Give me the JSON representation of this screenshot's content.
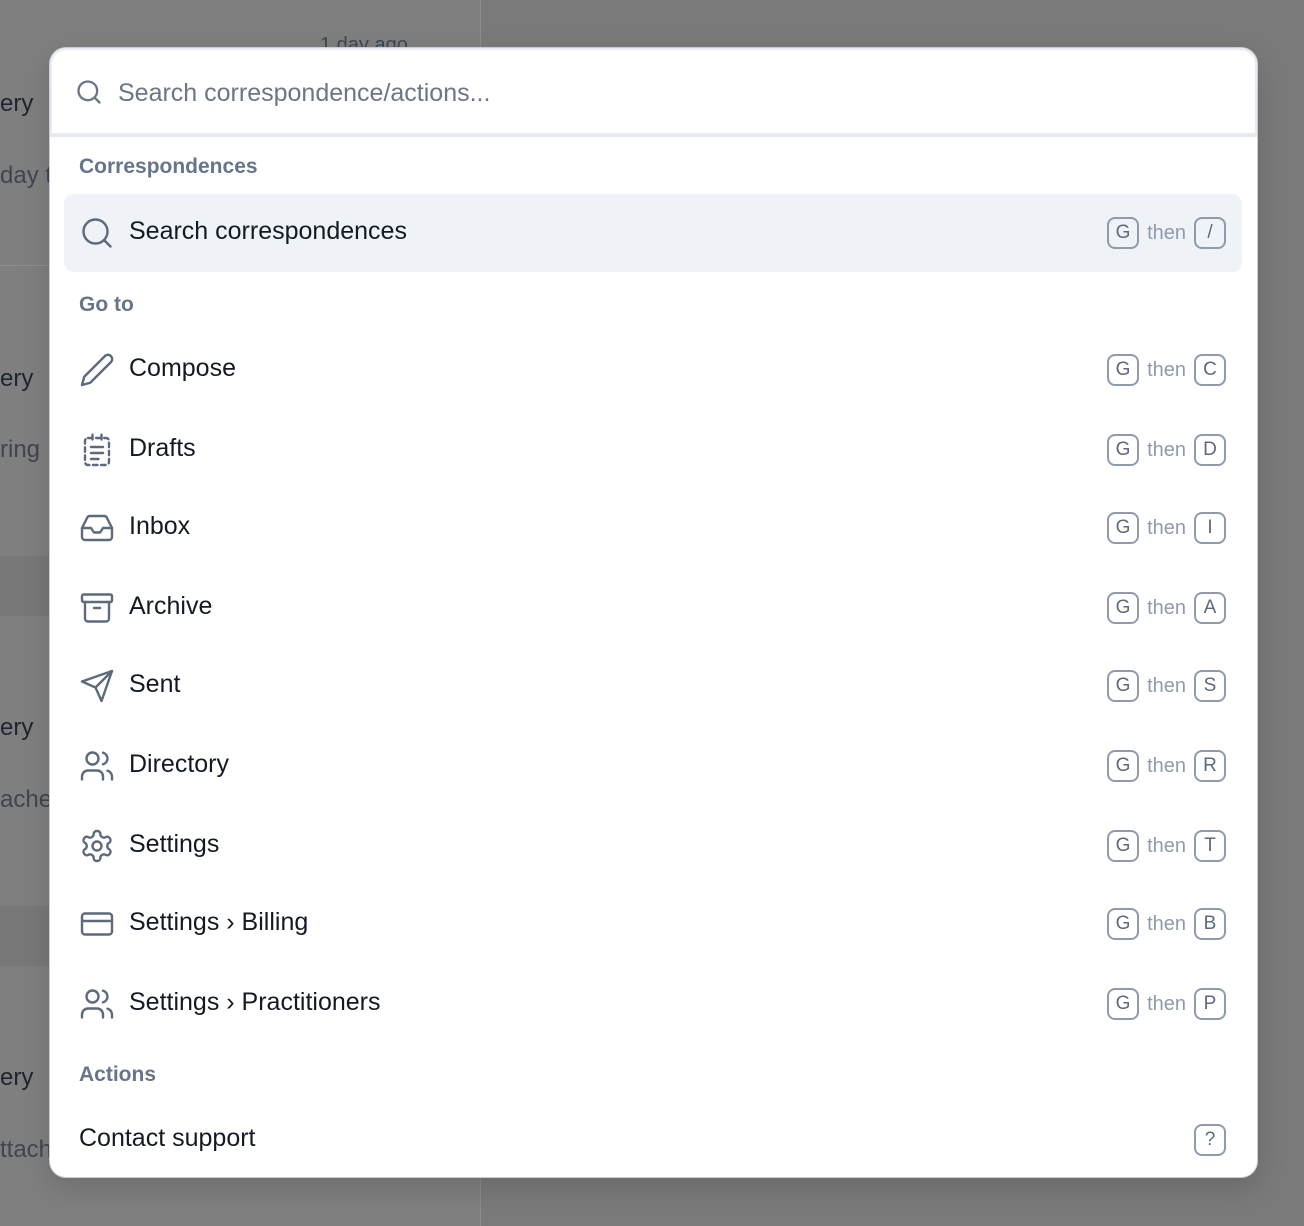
{
  "background": {
    "time_label": "1 day ago",
    "fragments": [
      {
        "text": "ery",
        "kind": "title"
      },
      {
        "text": "day t",
        "kind": "sub"
      },
      {
        "text": "ery",
        "kind": "title"
      },
      {
        "text": "ring",
        "kind": "sub"
      },
      {
        "text": "ery",
        "kind": "title"
      },
      {
        "text": "ache",
        "kind": "sub"
      },
      {
        "text": "ery",
        "kind": "title"
      },
      {
        "text": "ttach",
        "kind": "sub"
      }
    ]
  },
  "palette": {
    "search_placeholder": "Search correspondence/actions...",
    "then_label": "then",
    "sections": {
      "correspondences": "Correspondences",
      "go_to": "Go to",
      "actions": "Actions"
    },
    "items": [
      {
        "label": "Search correspondences",
        "icon": "search-icon",
        "keys": [
          "G",
          "/"
        ]
      },
      {
        "label": "Compose",
        "icon": "pencil-icon",
        "keys": [
          "G",
          "C"
        ]
      },
      {
        "label": "Drafts",
        "icon": "draft-document-icon",
        "keys": [
          "G",
          "D"
        ]
      },
      {
        "label": "Inbox",
        "icon": "inbox-icon",
        "keys": [
          "G",
          "I"
        ]
      },
      {
        "label": "Archive",
        "icon": "archive-box-icon",
        "keys": [
          "G",
          "A"
        ]
      },
      {
        "label": "Sent",
        "icon": "paper-plane-icon",
        "keys": [
          "G",
          "S"
        ]
      },
      {
        "label": "Directory",
        "icon": "users-icon",
        "keys": [
          "G",
          "R"
        ]
      },
      {
        "label": "Settings",
        "icon": "gear-icon",
        "keys": [
          "G",
          "T"
        ]
      },
      {
        "label": "Settings › Billing",
        "icon": "credit-card-icon",
        "keys": [
          "G",
          "B"
        ]
      },
      {
        "label": "Settings › Practitioners",
        "icon": "users-icon",
        "keys": [
          "G",
          "P"
        ]
      },
      {
        "label": "Contact support",
        "icon": "",
        "keys": [
          "?"
        ]
      }
    ]
  },
  "colors": {
    "overlay": "#7e7e7e",
    "active_row": "#eff2f7",
    "section_label": "#66758a",
    "key_border": "#8f9bab"
  }
}
